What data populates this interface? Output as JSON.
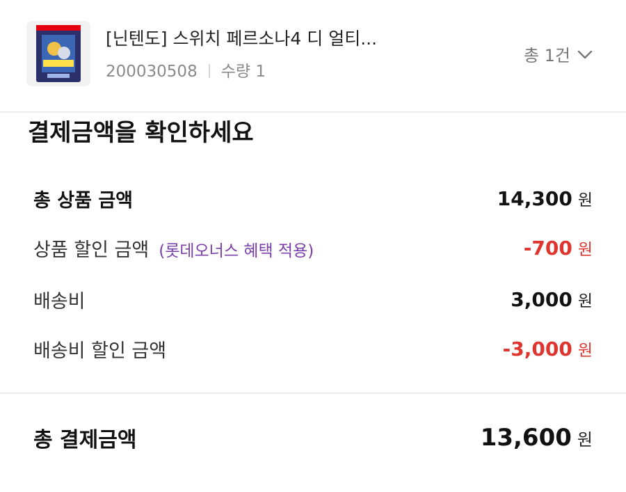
{
  "product": {
    "name": "[닌텐도] 스위치 페르소나4 디 얼티...",
    "code": "200030508",
    "quantity": "수량 1",
    "total_count": "총 1건"
  },
  "summary": {
    "heading": "결제금액을 확인하세요",
    "rows": [
      {
        "label": "총 상품 금액",
        "value": "14,300",
        "unit": "원"
      },
      {
        "label": "상품 할인 금액",
        "note": "(롯데오너스 혜택 적용)",
        "value": "-700",
        "unit": "원"
      },
      {
        "label": "배송비",
        "value": "3,000",
        "unit": "원"
      },
      {
        "label": "배송비 할인 금액",
        "value": "-3,000",
        "unit": "원"
      }
    ],
    "final": {
      "label": "총 결제금액",
      "value": "13,600",
      "unit": "원"
    }
  },
  "colors": {
    "discount": "#e0352e",
    "note": "#7a3ea8",
    "divider": "#ececec"
  },
  "icons": {
    "thumbnail": "product-thumbnail",
    "expand": "chevron-down-icon"
  }
}
